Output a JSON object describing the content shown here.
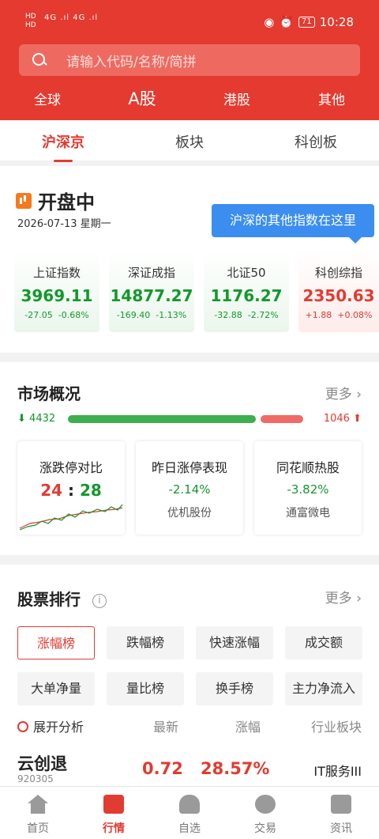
{
  "status_bar": {
    "left_top": "HD",
    "left_bottom": "HD",
    "signal": "4G .ıl 4G .ıl",
    "battery": "71",
    "time": "10:28"
  },
  "search": {
    "placeholder": "请输入代码/名称/简拼"
  },
  "market_tabs": [
    "全球",
    "A股",
    "港股",
    "其他"
  ],
  "sub_tabs": [
    "沪深京",
    "板块",
    "科创板"
  ],
  "open": {
    "title": "开盘中",
    "date": "2026-07-13 星期一",
    "tip": "沪深的其他指数在这里"
  },
  "indices": [
    {
      "name": "上证指数",
      "value": "3969.11",
      "change": "-27.05",
      "pct": "-0.68%"
    },
    {
      "name": "深证成指",
      "value": "14877.27",
      "change": "-169.40",
      "pct": "-1.13%"
    },
    {
      "name": "北证50",
      "value": "1176.27",
      "change": "-32.88",
      "pct": "-2.72%"
    },
    {
      "name": "科创综指",
      "value": "2350.63",
      "change": "+1.88",
      "pct": "+0.08%"
    }
  ],
  "overview": {
    "title": "市场概况",
    "more": "更多",
    "down_count": "4432",
    "up_count": "1046",
    "down_fraction": 0.81,
    "box1": {
      "title": "涨跌停对比",
      "left": "24",
      "sep": ":",
      "right": "28"
    },
    "box2": {
      "title": "昨日涨停表现",
      "value": "-2.14%",
      "sub": "优机股份"
    },
    "box3": {
      "title": "同花顺热股",
      "value": "-3.82%",
      "sub": "通富微电"
    }
  },
  "ranking": {
    "title": "股票排行",
    "more": "更多",
    "buttons": [
      "涨幅榜",
      "跌幅榜",
      "快速涨幅",
      "成交额",
      "大单净量",
      "量比榜",
      "换手榜",
      "主力净流入"
    ],
    "header": [
      "展开分析",
      "最新",
      "涨幅",
      "行业板块"
    ],
    "row": {
      "name": "云创退",
      "code": "920305",
      "price": "0.72",
      "pct": "28.57%",
      "industry": "IT服务III"
    }
  },
  "nav": [
    "首页",
    "行情",
    "自选",
    "交易",
    "资讯"
  ],
  "colors": {
    "brand": "#e53a2f",
    "up": "#e23b31",
    "down": "#13982c",
    "tip": "#3b8ef0"
  }
}
